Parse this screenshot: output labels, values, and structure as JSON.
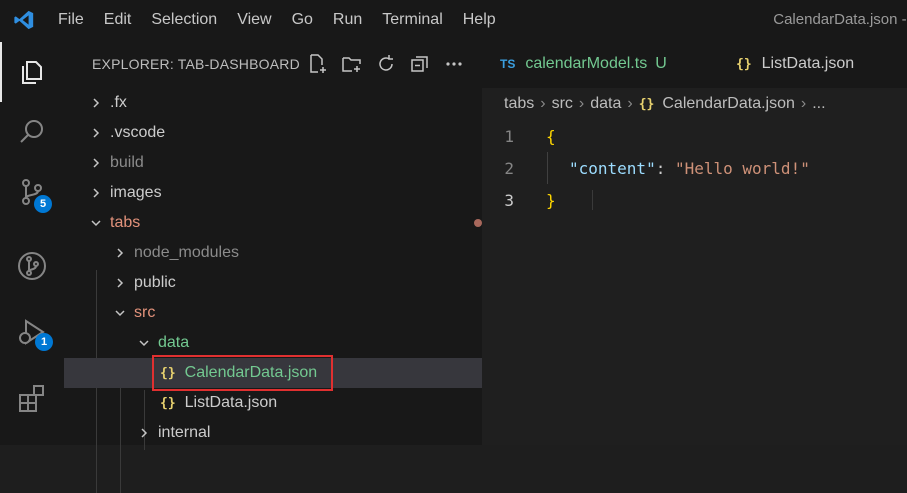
{
  "menu": [
    "File",
    "Edit",
    "Selection",
    "View",
    "Go",
    "Run",
    "Terminal",
    "Help"
  ],
  "window_title": "CalendarData.json - t",
  "activity": {
    "source_control_badge": "5",
    "debug_badge": "1"
  },
  "explorer": {
    "title": "EXPLORER: TAB-DASHBOARD",
    "items": [
      {
        "label": ".fx",
        "type": "folder",
        "expanded": false
      },
      {
        "label": ".vscode",
        "type": "folder",
        "expanded": false
      },
      {
        "label": "build",
        "type": "folder",
        "expanded": false
      },
      {
        "label": "images",
        "type": "folder",
        "expanded": false
      },
      {
        "label": "tabs",
        "type": "folder",
        "expanded": true
      },
      {
        "label": "node_modules",
        "type": "folder",
        "expanded": false
      },
      {
        "label": "public",
        "type": "folder",
        "expanded": false
      },
      {
        "label": "src",
        "type": "folder",
        "expanded": true
      },
      {
        "label": "data",
        "type": "folder",
        "expanded": true
      },
      {
        "label": "CalendarData.json",
        "type": "file",
        "status": "U"
      },
      {
        "label": "ListData.json",
        "type": "file"
      },
      {
        "label": "internal",
        "type": "folder",
        "expanded": false
      }
    ]
  },
  "tabs": [
    {
      "label": "calendarModel.ts",
      "icon": "TS",
      "status": "U"
    },
    {
      "label": "ListData.json",
      "icon": "{}"
    }
  ],
  "breadcrumb": [
    "tabs",
    "src",
    "data",
    "CalendarData.json",
    "..."
  ],
  "code": {
    "line_numbers": [
      "1",
      "2",
      "3"
    ],
    "open_brace": "{",
    "key": "\"content\"",
    "colon": ": ",
    "value": "\"Hello world!\"",
    "close_brace": "}"
  },
  "colors": {
    "accent": "#0078d4",
    "untracked": "#73c991",
    "modified_dot": "#a8685c",
    "highlight_box": "#e03030"
  }
}
